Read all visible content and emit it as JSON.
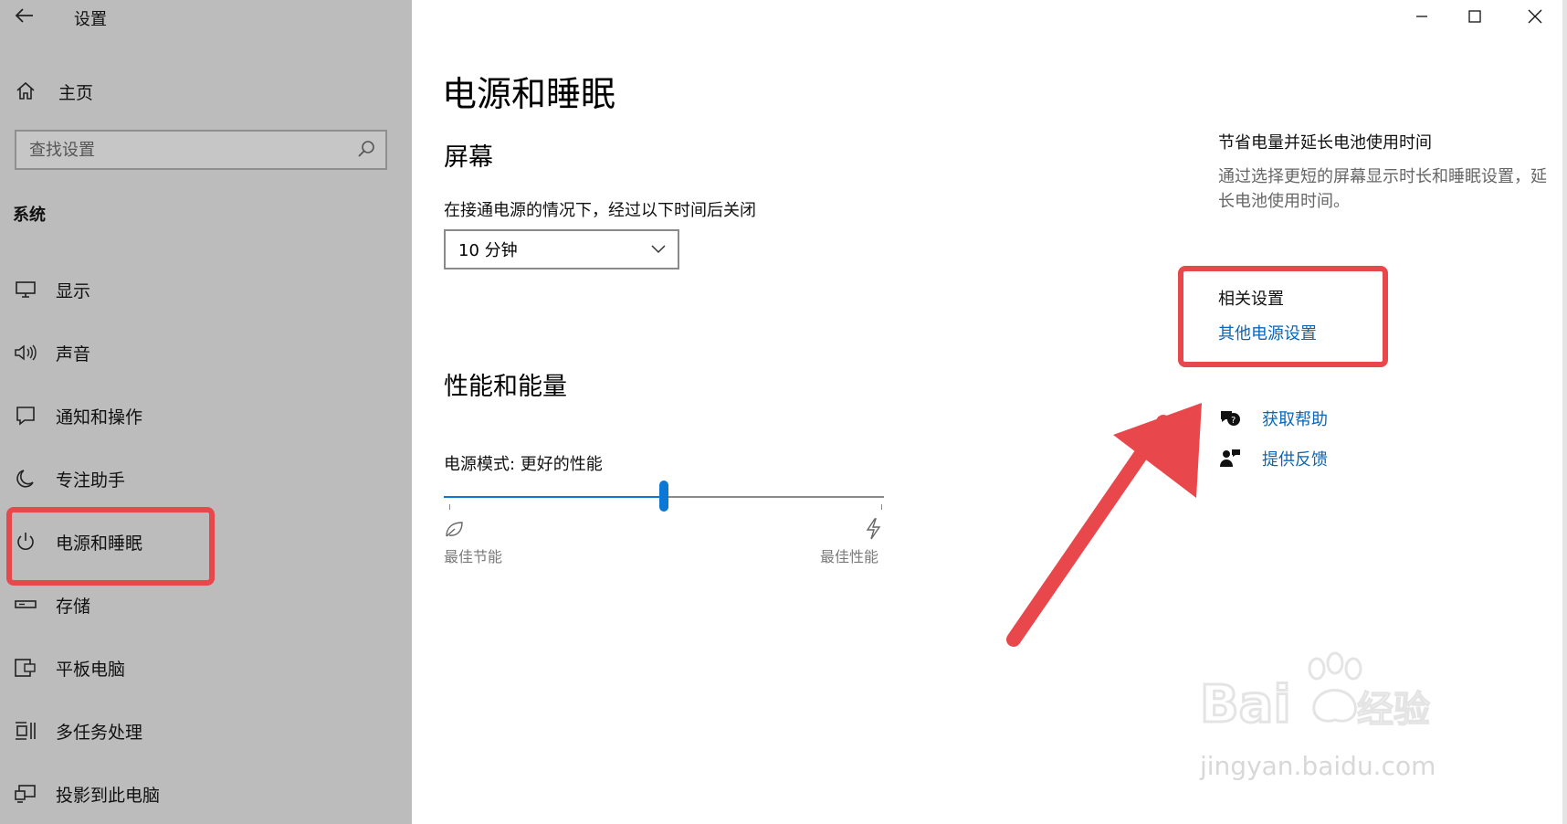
{
  "app": {
    "title": "设置"
  },
  "sidebar": {
    "home_label": "主页",
    "search_placeholder": "查找设置",
    "group_label": "系统",
    "items": [
      {
        "label": "显示",
        "icon": "monitor-icon"
      },
      {
        "label": "声音",
        "icon": "speaker-icon"
      },
      {
        "label": "通知和操作",
        "icon": "notification-icon"
      },
      {
        "label": "专注助手",
        "icon": "moon-icon"
      },
      {
        "label": "电源和睡眠",
        "icon": "power-icon",
        "selected": true
      },
      {
        "label": "存储",
        "icon": "storage-icon"
      },
      {
        "label": "平板电脑",
        "icon": "tablet-icon"
      },
      {
        "label": "多任务处理",
        "icon": "multitask-icon"
      },
      {
        "label": "投影到此电脑",
        "icon": "project-icon"
      }
    ]
  },
  "main": {
    "title": "电源和睡眠",
    "screen_section": {
      "heading": "屏幕",
      "label": "在接通电源的情况下，经过以下时间后关闭",
      "dropdown_value": "10 分钟"
    },
    "performance_section": {
      "heading": "性能和能量",
      "mode_label": "电源模式: 更好的性能",
      "slider_value": 0.5,
      "left_caption": "最佳节能",
      "right_caption": "最佳性能"
    }
  },
  "right_panel": {
    "tip_title": "节省电量并延长电池使用时间",
    "tip_desc": "通过选择更短的屏幕显示时长和睡眠设置，延长电池使用时间。",
    "related_title": "相关设置",
    "related_link": "其他电源设置",
    "help_link": "获取帮助",
    "feedback_link": "提供反馈"
  },
  "watermark": {
    "logo": "Bai du 经验",
    "sub": "jingyan.baidu.com"
  },
  "colors": {
    "accent": "#0a78d4",
    "link": "#0a66b8",
    "annotation": "#e8474c",
    "sidebar_bg": "#bcbcbc"
  }
}
